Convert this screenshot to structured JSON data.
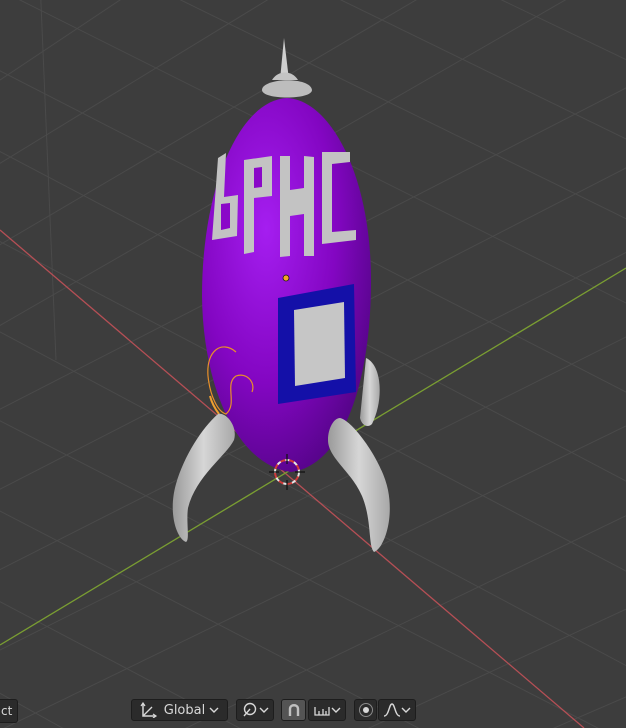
{
  "viewport": {
    "background": "#3d3d3d",
    "grid_color": "#4a4a4a",
    "x_axis_color": "#b54f55",
    "y_axis_color": "#7a9e32"
  },
  "rocket": {
    "body_color": "#8a08c8",
    "fin_color": "#c8c8c8",
    "panel_border_color": "#1410a8",
    "panel_fill_color": "#c6c6c6",
    "lettering": "бРhС",
    "selection_outline_color": "#e8902a"
  },
  "header": {
    "mode_label": "ct",
    "orientation_label": "Global",
    "icons": {
      "orientation": "transform-orientation-icon",
      "pivot": "pivot-point-icon",
      "snap": "snap-magnet-icon",
      "snap_target": "snap-increment-icon",
      "proportional": "proportional-editing-icon",
      "falloff": "falloff-curve-icon"
    }
  }
}
